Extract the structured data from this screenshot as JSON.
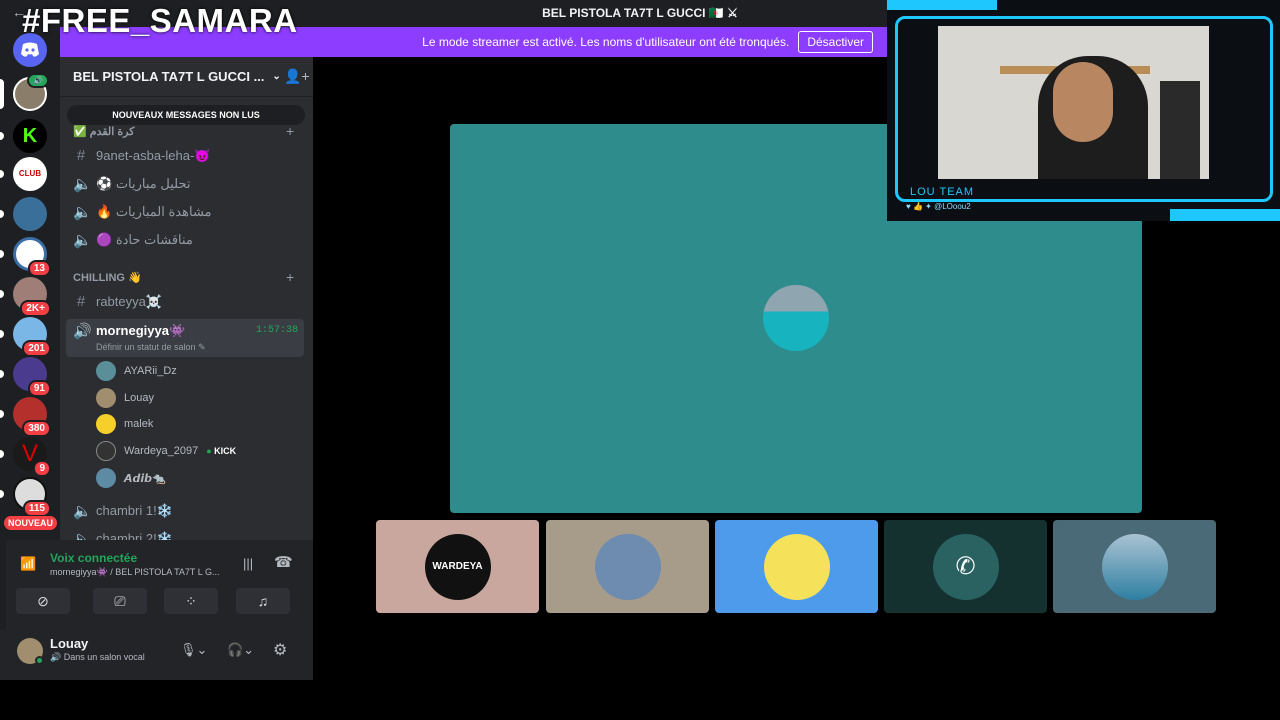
{
  "overlay_tag": "#FREE_SAMARA",
  "window": {
    "title": "BEL PISTOLA TA7T L GUCCI 🇩🇿 ⚔"
  },
  "banner": {
    "text": "Le mode streamer est activé. Les noms d'utilisateur ont été tronqués.",
    "button": "Désactiver"
  },
  "server": {
    "name": "BEL PISTOLA TA7T L GUCCI ...",
    "unread_pill": "NOUVEAUX MESSAGES NON LUS"
  },
  "rail": {
    "badges": [
      "13",
      "2K+",
      "201",
      "91",
      "380",
      "9",
      "115"
    ],
    "nouveau": "NOUVEAU"
  },
  "categories": {
    "top": "✅ كرة القدم",
    "chilling": "CHILLING 👋"
  },
  "channels": {
    "c1": "9anet-asba-leha-😈",
    "c2": "⚽ تحليل مباريات",
    "c3": "🔥 مشاهدة المباريات",
    "c4": "🟣 مناقشات حادة",
    "c5": "rabteyya☠️",
    "active": "mornegiyya👾",
    "active_timer": "1:57:38",
    "active_status": "Définir un statut de salon ✎",
    "c7": "chambri 1!❄️",
    "c8": "chambri 2!❄️"
  },
  "voice_users": [
    {
      "name": "AYARii_Dz",
      "color": "#5a8f9a"
    },
    {
      "name": "Louay",
      "color": "#a08e6e"
    },
    {
      "name": "malek",
      "color": "#f5cf2a"
    },
    {
      "name": "Wardeya_2097",
      "color": "#333",
      "tag": "KICK"
    },
    {
      "name": "𝘼𝙙𝙞𝙗🐀",
      "color": "#5d8ba3"
    }
  ],
  "voice_panel": {
    "status": "Voix connectée",
    "location": "mornegiyya👾 / BEL PISTOLA TA7T L G..."
  },
  "user_panel": {
    "name": "Louay",
    "status": "Dans un salon vocal"
  },
  "webcam": {
    "team": "LOU TEAM",
    "handle": "@LOoou2"
  },
  "colors": {
    "accent": "#8c3dff",
    "stage": "#2f8c8c",
    "online": "#23a55a",
    "cam_border": "#1ec8ff"
  },
  "tiles": [
    {
      "bg": "#c9a79e",
      "label": "WARDEYA"
    },
    {
      "bg": "#a79c89",
      "label": ""
    },
    {
      "bg": "#4d9bea",
      "label": ""
    },
    {
      "bg": "#14302f",
      "label": ""
    },
    {
      "bg": "#4a6a78",
      "label": ""
    }
  ]
}
